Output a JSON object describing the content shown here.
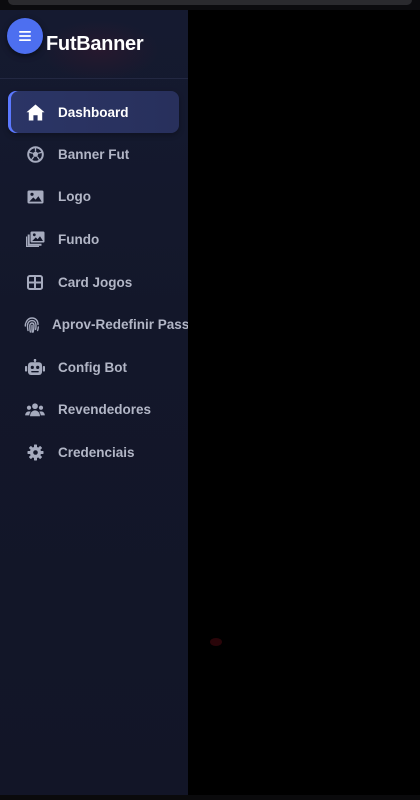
{
  "app": {
    "title": "FutBanner"
  },
  "sidebar": {
    "items": [
      {
        "label": "Dashboard",
        "icon": "home-icon",
        "active": true
      },
      {
        "label": "Banner Fut",
        "icon": "soccer-ball-icon",
        "active": false
      },
      {
        "label": "Logo",
        "icon": "image-icon",
        "active": false
      },
      {
        "label": "Fundo",
        "icon": "images-icon",
        "active": false
      },
      {
        "label": "Card Jogos",
        "icon": "grid-icon",
        "active": false
      },
      {
        "label": "Aprov-Redefinir Pass",
        "icon": "fingerprint-icon",
        "active": false
      },
      {
        "label": "Config Bot",
        "icon": "robot-icon",
        "active": false
      },
      {
        "label": "Revendedores",
        "icon": "users-icon",
        "active": false
      },
      {
        "label": "Credenciais",
        "icon": "gear-icon",
        "active": false
      }
    ]
  },
  "colors": {
    "accent": "#4d6ff0",
    "sidebar_bg": "#13172a",
    "active_item_bg": "#2b3566",
    "text": "#b2b6c6",
    "content_bg": "#000000"
  }
}
